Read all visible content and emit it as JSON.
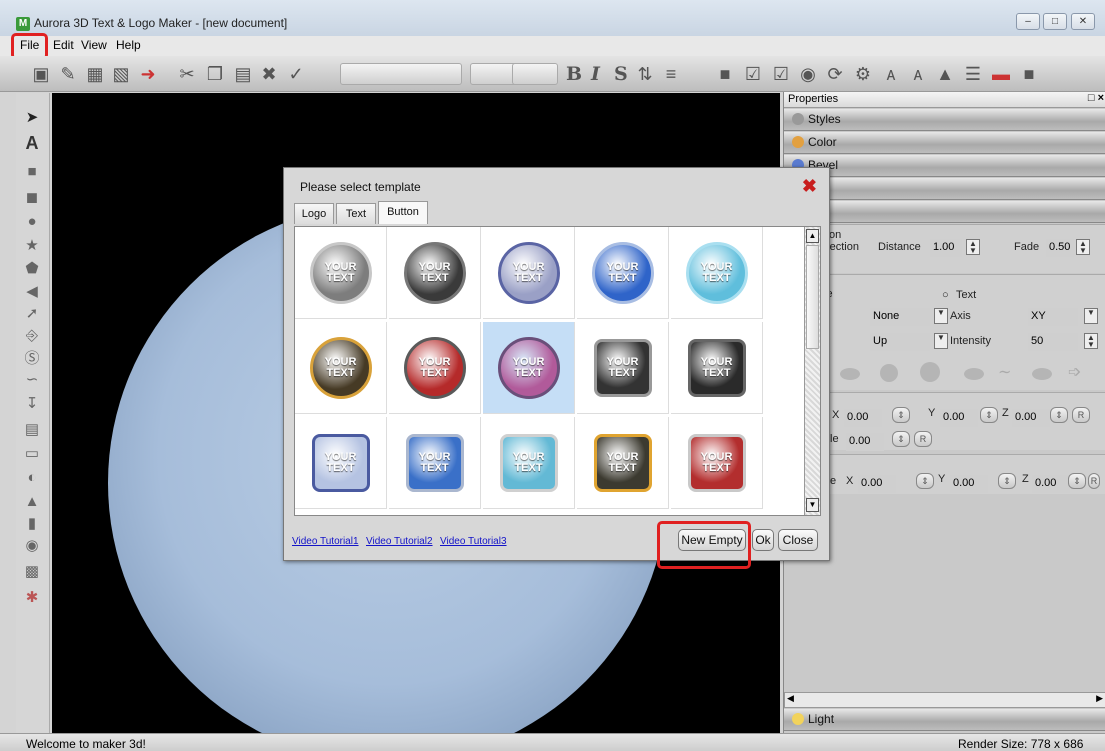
{
  "window": {
    "title": "Aurora 3D Text & Logo Maker - [new document]",
    "app_icon_letter": "M"
  },
  "menu": {
    "file": "File",
    "edit": "Edit",
    "view": "View",
    "help": "Help"
  },
  "toolbar": {
    "bold": "B",
    "italic": "I",
    "strike": "S"
  },
  "properties": {
    "header": "Properties",
    "sections": {
      "styles": "Styles",
      "color": "Color",
      "bevel": "Bevel",
      "shape": "pe",
      "align": "ign",
      "light": "Light"
    },
    "reflection": {
      "label_partial": "ction",
      "reflection_label": "eflection",
      "distance_label": "Distance",
      "distance_value": "1.00",
      "fade_label": "Fade",
      "fade_value": "0.50"
    },
    "art": {
      "label_partial": "rt",
      "shape_partial": "ipe",
      "text_radio": "Text",
      "none_value": "None",
      "axis_label": "Axis",
      "axis_value": "XY",
      "on_partial": "on",
      "up_value": "Up",
      "intensity_label": "Intensity",
      "intensity_value": "50"
    },
    "position": {
      "x_label": "X",
      "x_value": "0.00",
      "y_label": "Y",
      "y_value": "0.00",
      "z_label": "Z",
      "z_value": "0.00",
      "r_button": "R",
      "angle_partial": "le",
      "angle_value": "0.00",
      "angle_r": "R"
    },
    "scale": {
      "e_partial": "e",
      "x_label": "X",
      "x_value": "0.00",
      "y_label": "Y",
      "y_value": "0.00",
      "z_label": "Z",
      "z_value": "0.00",
      "r_button": "R"
    }
  },
  "dialog": {
    "title": "Please select template",
    "tabs": [
      "Logo",
      "Text",
      "Button"
    ],
    "active_tab": "Button",
    "templates": [
      {
        "line1": "YOUR",
        "line2": "TEXT",
        "bg": "#7d7d7d",
        "ring": "#c7c7c7"
      },
      {
        "line1": "YOUR",
        "line2": "TEXT",
        "bg": "#3a3a3a",
        "ring": "#777777"
      },
      {
        "line1": "YOUR",
        "line2": "TEXT",
        "bg": "#9aa0c6",
        "ring": "#5a64a4"
      },
      {
        "line1": "YOUR",
        "line2": "TEXT",
        "bg": "#2f64c9",
        "ring": "#a8bde3"
      },
      {
        "line1": "YOUR",
        "line2": "TEXT",
        "bg": "#5fbedc",
        "ring": "#a9dff0"
      },
      {
        "line1": "YOUR",
        "line2": "TEXT",
        "bg": "#463a25",
        "ring": "#d9a23a"
      },
      {
        "line1": "YOUR",
        "line2": "TEXT",
        "bg": "#b52a2a",
        "ring": "#5a5a5a"
      },
      {
        "line1": "YOUR",
        "line2": "TEXT",
        "bg": "#b15a9a",
        "ring": "#6a4f7a"
      },
      {
        "line1": "YOUR",
        "line2": "TEXT",
        "bg": "#333333",
        "ring": "#999999"
      },
      {
        "line1": "YOUR",
        "line2": "TEXT",
        "bg": "#2a2a2a",
        "ring": "#666666"
      },
      {
        "line1": "YOUR",
        "line2": "TEXT",
        "bg": "#b5c3e2",
        "ring": "#4a5aa0"
      },
      {
        "line1": "YOUR",
        "line2": "TEXT",
        "bg": "#3a70c8",
        "ring": "#aab7cf"
      },
      {
        "line1": "YOUR",
        "line2": "TEXT",
        "bg": "#63b9d5",
        "ring": "#d0d0d0"
      },
      {
        "line1": "YOUR",
        "line2": "TEXT",
        "bg": "#3c3a30",
        "ring": "#e0a430"
      },
      {
        "line1": "YOUR",
        "line2": "TEXT",
        "bg": "#b32e2e",
        "ring": "#c9c9c9"
      }
    ],
    "selected_index": 7,
    "links": [
      "Video Tutorial1",
      "Video Tutorial2",
      "Video Tutorial3"
    ],
    "buttons": {
      "new_empty": "New Empty",
      "ok": "Ok",
      "close": "Close"
    }
  },
  "status": {
    "message": "Welcome to maker 3d!",
    "render_size": "Render Size: 778 x 686"
  },
  "colors": {
    "highlight": "#e02020",
    "canvas": "#000000",
    "link": "#1313c8",
    "close_x": "#c81d1d"
  }
}
